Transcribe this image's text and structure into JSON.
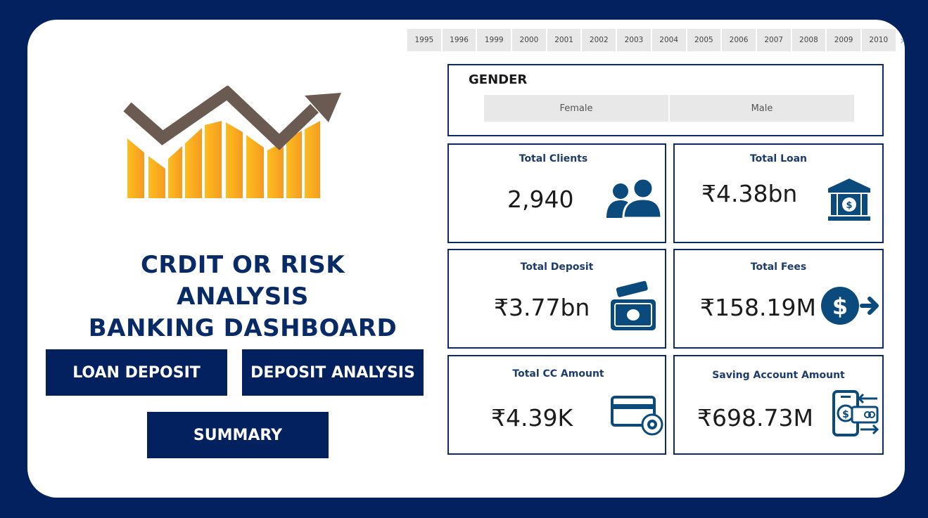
{
  "years": [
    "1995",
    "1996",
    "1999",
    "2000",
    "2001",
    "2002",
    "2003",
    "2004",
    "2005",
    "2006",
    "2007",
    "2008",
    "2009",
    "2010"
  ],
  "dashboard_title": {
    "line1": "CRDIT OR RISK ANALYSIS",
    "line2": "BANKING DASHBOARD"
  },
  "nav": {
    "loan_deposit": "LOAN DEPOSIT",
    "deposit_analysis": "DEPOSIT ANALYSIS",
    "summary": "SUMMARY"
  },
  "gender": {
    "title": "GENDER",
    "options": [
      "Female",
      "Male"
    ]
  },
  "kpis": {
    "total_clients": {
      "label": "Total Clients",
      "value": "2,940",
      "icon": "users-icon"
    },
    "total_loan": {
      "label": "Total Loan",
      "value": "₹4.38bn",
      "icon": "bank-icon"
    },
    "total_deposit": {
      "label": "Total Deposit",
      "value": "₹3.77bn",
      "icon": "cash-icon"
    },
    "total_fees": {
      "label": "Total Fees",
      "value": "₹158.19M",
      "icon": "dollar-arrow-icon"
    },
    "total_cc_amount": {
      "label": "Total CC Amount",
      "value": "₹4.39K",
      "icon": "credit-card-icon"
    },
    "saving_account_amount": {
      "label": "Saving Account Amount",
      "value": "₹698.73M",
      "icon": "mobile-payment-icon"
    }
  },
  "colors": {
    "background": "#03215f",
    "accent": "#0c2a66",
    "icon": "#0b4a7d",
    "logo_arrow": "#6b5a51",
    "logo_bars": "#f7a81e"
  }
}
